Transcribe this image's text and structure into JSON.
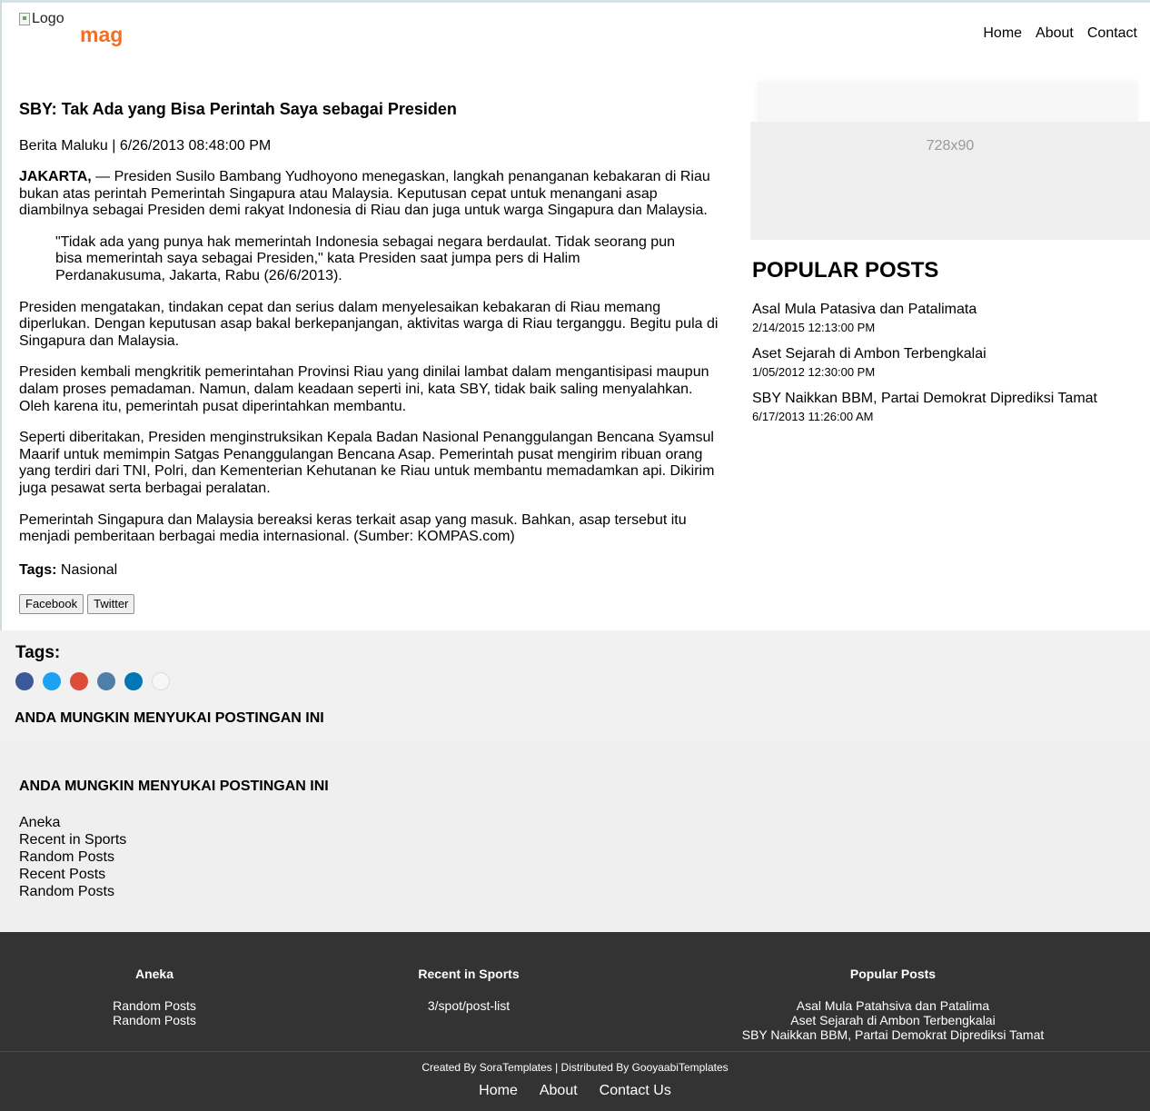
{
  "header": {
    "logo_alt": "Logo",
    "brand": "mag",
    "nav": [
      "Home",
      "About",
      "Contact"
    ]
  },
  "article": {
    "title": "SBY: Tak Ada yang Bisa Perintah Saya sebagai Presiden",
    "meta": "Berita Maluku | 6/26/2013 08:48:00 PM",
    "lead": "JAKARTA,",
    "p1_rest": " — Presiden Susilo Bambang Yudhoyono menegaskan, langkah penanganan kebakaran di Riau bukan atas perintah Pemerintah Singapura atau Malaysia. Keputusan cepat untuk menangani asap diambilnya sebagai Presiden demi rakyat Indonesia di Riau dan juga untuk warga Singapura dan Malaysia.",
    "quote": "\"Tidak ada yang punya hak memerintah Indonesia sebagai negara berdaulat. Tidak seorang pun bisa memerintah saya sebagai Presiden,\" kata Presiden saat jumpa pers di Halim Perdanakusuma, Jakarta, Rabu (26/6/2013).",
    "p2": "Presiden mengatakan, tindakan cepat dan serius dalam menyelesaikan kebakaran di Riau memang diperlukan. Dengan keputusan asap bakal berkepanjangan, aktivitas warga di Riau terganggu. Begitu pula di Singapura dan Malaysia.",
    "p3": "Presiden kembali mengkritik pemerintahan Provinsi Riau yang dinilai lambat dalam mengantisipasi maupun dalam proses pemadaman. Namun, dalam keadaan seperti ini, kata SBY, tidak baik saling menyalahkan. Oleh karena itu, pemerintah pusat diperintahkan membantu.",
    "p4": "Seperti diberitakan, Presiden menginstruksikan Kepala Badan Nasional Penanggulangan Bencana Syamsul Maarif untuk memimpin Satgas Penanggulangan Bencana Asap. Pemerintah pusat mengirim ribuan orang yang terdiri dari TNI, Polri, dan Kementerian Kehutanan ke Riau untuk membantu memadamkan api. Dikirim juga pesawat serta berbagai peralatan.",
    "p5": "Pemerintah Singapura dan Malaysia bereaksi keras terkait asap yang masuk. Bahkan, asap tersebut itu menjadi pemberitaan berbagai media internasional. (Sumber: KOMPAS.com)",
    "tags_label": "Tags:",
    "tags_value": " Nasional",
    "share": [
      "Facebook",
      "Twitter"
    ]
  },
  "sidebar": {
    "ad_label": "728x90",
    "popular_title": "POPULAR POSTS",
    "popular": [
      {
        "title": "Asal Mula Patasiva dan Patalimata",
        "date": "2/14/2015 12:13:00 PM"
      },
      {
        "title": "Aset Sejarah di Ambon Terbengkalai",
        "date": "1/05/2012 12:30:00 PM"
      },
      {
        "title": "SBY Naikkan BBM, Partai Demokrat Diprediksi Tamat",
        "date": "6/17/2013 11:26:00 AM"
      }
    ]
  },
  "tags_band": {
    "label": "Tags:",
    "dot_colors": [
      "#3b5998",
      "#1da1f2",
      "#dd4b39",
      "#4f7ea7",
      "#0077b5",
      "#f7f7f7"
    ],
    "heading": "ANDA MUNGKIN MENYUKAI POSTINGAN INI"
  },
  "related": {
    "heading": "ANDA MUNGKIN MENYUKAI POSTINGAN INI",
    "items": [
      "Aneka",
      "Recent in Sports",
      "Random Posts",
      "Recent Posts",
      "Random Posts"
    ]
  },
  "footer": {
    "col1_title": "Aneka",
    "col1_items": [
      "Random Posts",
      "Random Posts"
    ],
    "col2_title": "Recent in Sports",
    "col2_items": [
      "3/spot/post-list"
    ],
    "col3_title": "Popular Posts",
    "col3_items": [
      "Asal Mula Patahsiva dan Patalima",
      "Aset Sejarah di Ambon Terbengkalai",
      "SBY Naikkan BBM, Partai Demokrat Diprediksi Tamat"
    ],
    "credit": "Created By SoraTemplates | Distributed By GooyaabiTemplates",
    "nav": [
      "Home",
      "About",
      "Contact Us"
    ]
  }
}
